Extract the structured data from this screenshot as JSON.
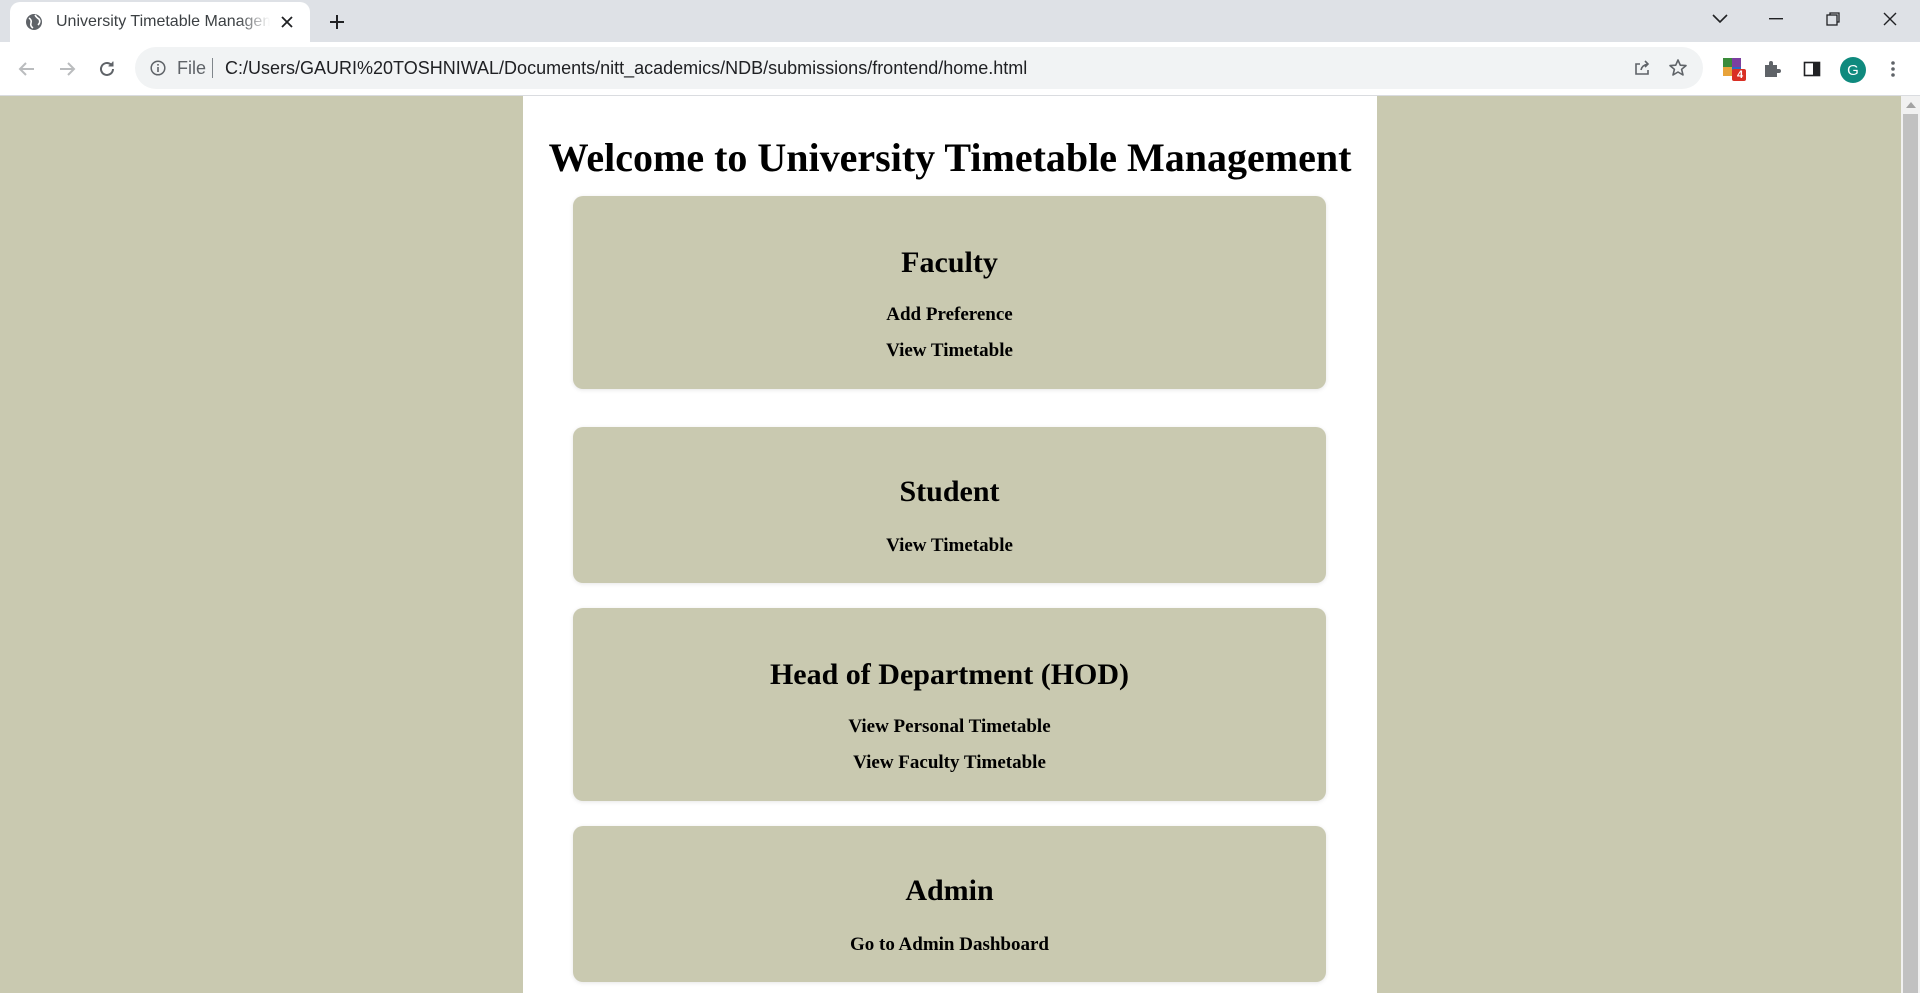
{
  "browser": {
    "tab_title": "University Timetable Management",
    "url_scheme_label": "File",
    "url": "C:/Users/GAURI%20TOSHNIWAL/Documents/nitt_academics/NDB/submissions/frontend/home.html",
    "extension_badge": "4",
    "profile_initial": "G",
    "accent_color": "#0f8a7e"
  },
  "page": {
    "title": "Welcome to University Timetable Management",
    "background_color": "#c9c9b0",
    "card_color": "#c9c9b0",
    "sections": [
      {
        "heading": "Faculty",
        "links": [
          "Add Preference",
          "View Timetable"
        ]
      },
      {
        "heading": "Student",
        "links": [
          "View Timetable"
        ]
      },
      {
        "heading": "Head of Department (HOD)",
        "links": [
          "View Personal Timetable",
          "View Faculty Timetable"
        ]
      },
      {
        "heading": "Admin",
        "links": [
          "Go to Admin Dashboard"
        ]
      }
    ]
  }
}
